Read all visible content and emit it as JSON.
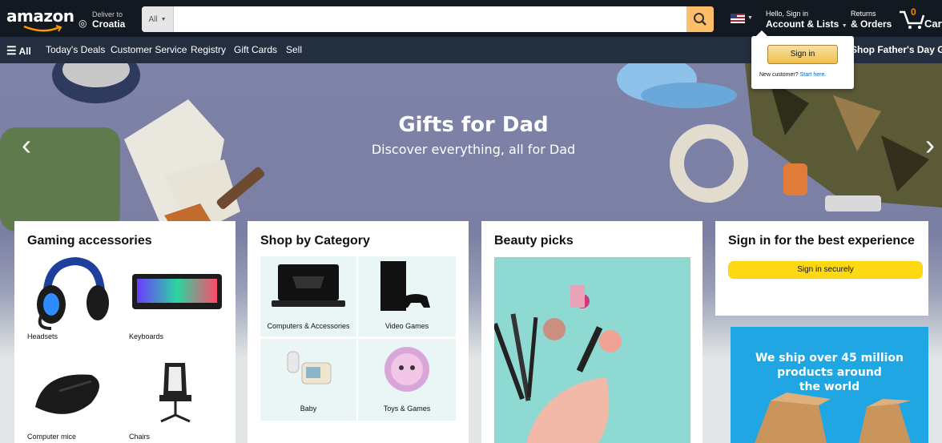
{
  "header": {
    "logo": "amazon",
    "deliver_line1": "Deliver to",
    "deliver_line2": "Croatia",
    "search_category": "All",
    "search_placeholder": "",
    "account_line1": "Hello, Sign in",
    "account_line2": "Account & Lists",
    "returns_line1": "Returns",
    "returns_line2": "& Orders",
    "cart_count": "0",
    "cart_label": "Cart"
  },
  "subnav": {
    "all": "All",
    "items": [
      "Today's Deals",
      "Customer Service",
      "Registry",
      "Gift Cards",
      "Sell"
    ],
    "promo": "Shop Father's Day Gifts"
  },
  "hero": {
    "title": "Gifts for Dad",
    "subtitle": "Discover everything, all for Dad"
  },
  "flyout": {
    "button": "Sign in",
    "new_customer": "New customer?",
    "start_here": "Start here."
  },
  "cards": {
    "gaming": {
      "title": "Gaming accessories",
      "tiles": [
        "Headsets",
        "Keyboards",
        "Computer mice",
        "Chairs"
      ]
    },
    "category": {
      "title": "Shop by Category",
      "tiles": [
        "Computers & Accessories",
        "Video Games",
        "Baby",
        "Toys & Games"
      ]
    },
    "beauty": {
      "title": "Beauty picks"
    },
    "signin": {
      "title": "Sign in for the best experience",
      "button": "Sign in securely"
    },
    "ship": {
      "lines": [
        "We ship over 45 million",
        "products around",
        "the world"
      ]
    }
  },
  "colors": {
    "nav_dark": "#131921",
    "nav_sub": "#232f3e",
    "search_button": "#febd69",
    "cart_count": "#f08804",
    "button_yellow": "#ffd814",
    "link_blue": "#0066c0"
  }
}
